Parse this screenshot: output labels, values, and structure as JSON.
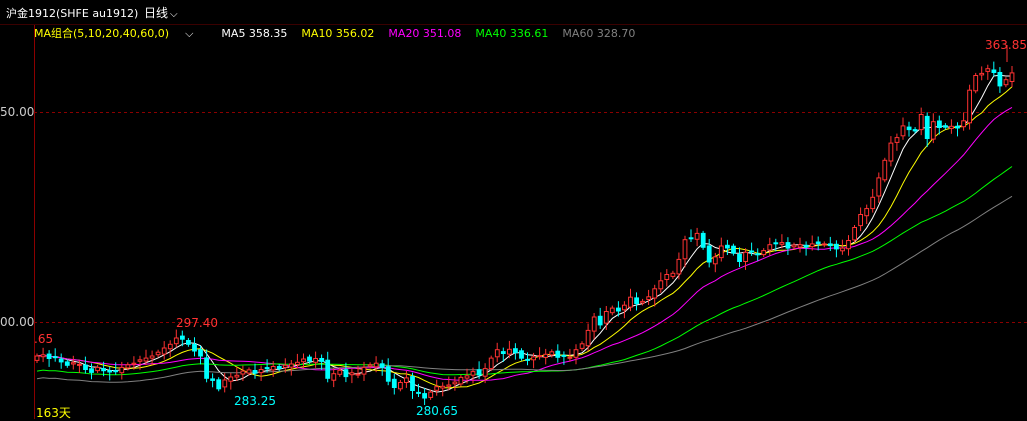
{
  "header": {
    "title": "沪金1912(SHFE au1912)",
    "period_label": "日线",
    "period_chevron": "⌵"
  },
  "ma_legend": {
    "combo": "MA组合(5,10,20,40,60,0)",
    "combo_chevron": "⌵",
    "items": [
      {
        "label": "MA5 358.35",
        "color": "#ffffff"
      },
      {
        "label": "MA10 356.02",
        "color": "#ffff00"
      },
      {
        "label": "MA20 351.08",
        "color": "#ff00ff"
      },
      {
        "label": "MA40 336.61",
        "color": "#00ff00"
      },
      {
        "label": "MA60 328.70",
        "color": "#808080"
      }
    ]
  },
  "axis": {
    "grid_labels": [
      "50.00",
      "00.00"
    ],
    "price_top": 364.6,
    "price_bottom": 279.5
  },
  "annotations": {
    "high_value": "363.85",
    "low_value": "280.65",
    "left_value": ".65",
    "peak_value": "297.40",
    "trough_value": "283.25",
    "count_label": "163天"
  },
  "colors": {
    "up": "#ff3232",
    "down": "#00ffff",
    "grid": "#8b0000",
    "text_red": "#ff3232",
    "text_cyan": "#00ffff",
    "text_yellow": "#ffff00"
  },
  "chart_data": {
    "type": "candlestick",
    "closes": [
      291.9,
      292.2,
      291.3,
      291.5,
      290.5,
      289.7,
      290.3,
      289.9,
      288.7,
      288.0,
      289.2,
      288.4,
      288.1,
      288.4,
      289.2,
      289.8,
      290.2,
      291.0,
      291.4,
      291.9,
      292.8,
      293.8,
      294.7,
      296.2,
      295.9,
      294.7,
      293.1,
      291.9,
      286.6,
      286.1,
      284.1,
      286.2,
      286.9,
      287.3,
      288.3,
      288.6,
      287.8,
      288.7,
      288.9,
      289.4,
      288.9,
      289.7,
      290.0,
      290.4,
      291.2,
      290.7,
      291.3,
      290.6,
      286.6,
      287.7,
      288.5,
      287.0,
      287.9,
      287.6,
      289.2,
      289.8,
      290.2,
      289.2,
      285.9,
      284.4,
      285.6,
      286.7,
      283.7,
      283.1,
      281.9,
      283.3,
      284.6,
      284.7,
      285.0,
      285.7,
      286.8,
      287.2,
      288.2,
      287.4,
      288.9,
      291.4,
      293.4,
      292.5,
      293.5,
      292.7,
      291.4,
      291.0,
      291.7,
      292.0,
      292.3,
      292.9,
      291.6,
      291.8,
      291.6,
      293.4,
      294.8,
      298.0,
      301.2,
      299.3,
      302.5,
      303.3,
      302.6,
      304.0,
      305.9,
      304.4,
      304.9,
      306.0,
      307.9,
      309.8,
      311.3,
      311.6,
      314.9,
      319.6,
      320.0,
      321.1,
      317.8,
      314.3,
      315.5,
      318.1,
      317.6,
      316.4,
      314.4,
      316.6,
      316.7,
      316.2,
      317.0,
      318.4,
      318.8,
      318.9,
      317.6,
      318.3,
      318.4,
      317.8,
      318.6,
      318.7,
      318.6,
      318.2,
      317.4,
      317.6,
      319.4,
      322.5,
      325.6,
      327.0,
      329.7,
      334.3,
      338.5,
      342.6,
      343.9,
      346.7,
      345.8,
      345.5,
      349.4,
      343.7,
      347.7,
      346.3,
      346.4,
      346.6,
      346.2,
      347.9,
      355.2,
      358.7,
      359.2,
      360.3,
      359.4,
      356.2,
      357.7,
      359.3
    ],
    "ma": [
      {
        "name": "MA5",
        "value": 358.35,
        "color": "#ffffff"
      },
      {
        "name": "MA10",
        "value": 356.02,
        "color": "#ffff00"
      },
      {
        "name": "MA20",
        "value": 351.08,
        "color": "#ff00ff"
      },
      {
        "name": "MA40",
        "value": 336.61,
        "color": "#00ff00"
      },
      {
        "name": "MA60",
        "value": 328.7,
        "color": "#808080"
      }
    ],
    "high": 363.85,
    "low": 280.65,
    "gridlines": [
      350,
      300
    ]
  }
}
